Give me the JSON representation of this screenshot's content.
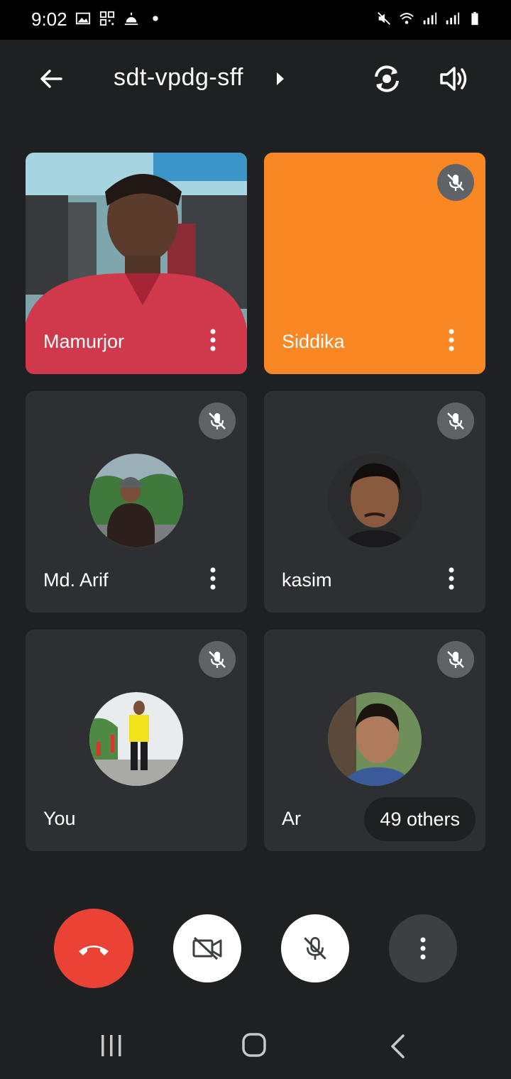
{
  "status_bar": {
    "time": "9:02",
    "left_icons": [
      "gallery-icon",
      "qr-icon",
      "weather-icon",
      "dot-icon"
    ],
    "right_icons": [
      "mute-icon",
      "wifi-icon",
      "signal-icon",
      "signal-icon",
      "battery-icon"
    ]
  },
  "header": {
    "meeting_code": "sdt-vpdg-sff"
  },
  "participants": [
    {
      "name": "Mamurjor",
      "tile_color": "#c2303e",
      "muted": false,
      "video": true
    },
    {
      "name": "Siddika",
      "tile_color": "#f98723",
      "muted": true,
      "video": false
    },
    {
      "name": "Md. Arif",
      "muted": true
    },
    {
      "name": "kasim",
      "muted": true
    },
    {
      "name": "You",
      "muted": true
    },
    {
      "name": "Ar",
      "muted": true
    }
  ],
  "others_count_label": "49 others",
  "controls": {
    "end_call_color": "#ea4335"
  },
  "colors": {
    "background": "#1f2022",
    "tile": "#2e2f32",
    "mute_badge": "#5f6368"
  }
}
